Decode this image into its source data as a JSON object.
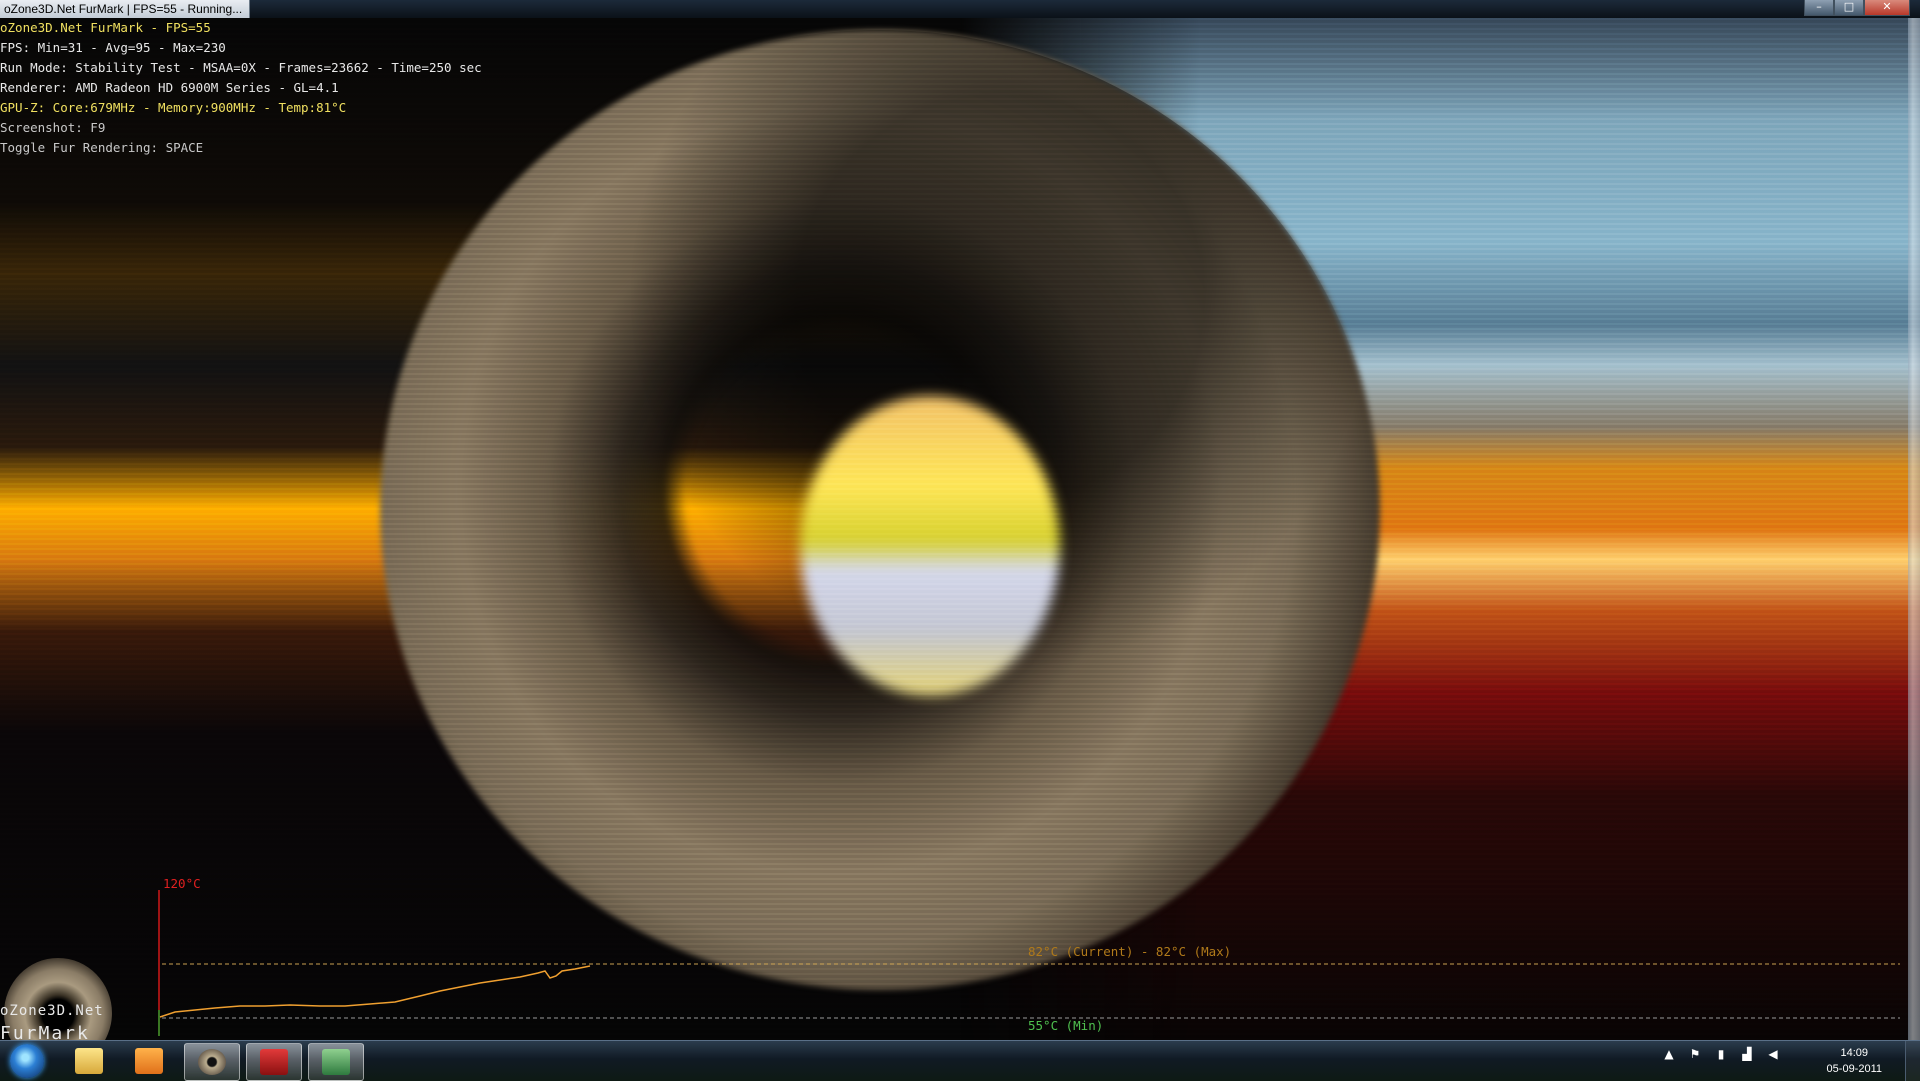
{
  "window": {
    "title": "oZone3D.Net FurMark | FPS=55 - Running...",
    "controls": {
      "minimize": "–",
      "maximize": "□",
      "close": "✕"
    }
  },
  "hud": {
    "line1": "oZone3D.Net FurMark - FPS=55",
    "line2": "FPS: Min=31 - Avg=95 - Max=230",
    "line3": "Run Mode: Stability Test - MSAA=0X - Frames=23662 - Time=250 sec",
    "line4": "Renderer: AMD Radeon HD 6900M Series - GL=4.1",
    "line5": "GPU-Z: Core:679MHz - Memory:900MHz - Temp:81°C",
    "line6": "Screenshot: F9",
    "line7": "Toggle Fur Rendering: SPACE"
  },
  "temp_graph": {
    "max_label": "120°C",
    "current_label": "82°C (Current) - 82°C (Max)",
    "min_label": "55°C (Min)",
    "trace_color": "#f0a030",
    "axis_color": "#d01818",
    "baseline_color": "#2a9a2a"
  },
  "brand": {
    "line1": "oZone3D.Net",
    "line2": "FurMark"
  },
  "taskbar": {
    "start_icon": "windows-orb-icon",
    "pinned": [
      "folder-icon",
      "media-player-icon",
      "furmark-icon",
      "aida64-icon",
      "gpu-z-icon"
    ],
    "tray_icons": [
      "show-hidden-icon",
      "flag-icon",
      "power-icon",
      "network-icon",
      "volume-icon"
    ],
    "clock_time": "14:09",
    "clock_date": "05-09-2011"
  }
}
